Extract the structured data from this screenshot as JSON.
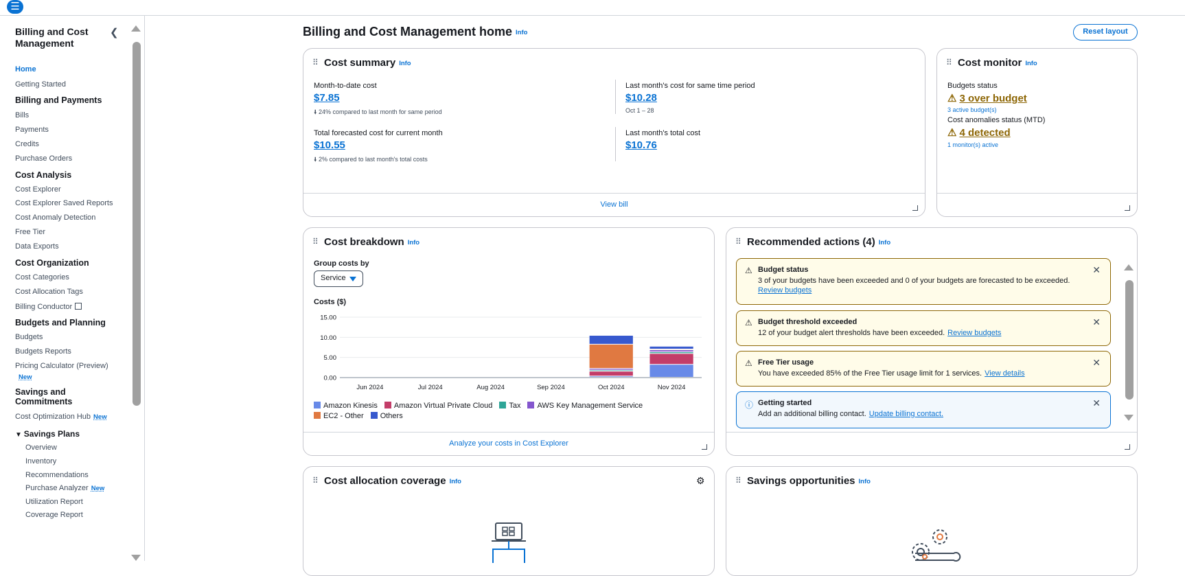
{
  "topbar": {
    "menu_icon": "hamburger-icon"
  },
  "sidebar": {
    "title": "Billing and Cost Management",
    "items": [
      {
        "label": "Home",
        "type": "item",
        "active": true
      },
      {
        "label": "Getting Started",
        "type": "item"
      },
      {
        "label": "Billing and Payments",
        "type": "head"
      },
      {
        "label": "Bills",
        "type": "item"
      },
      {
        "label": "Payments",
        "type": "item"
      },
      {
        "label": "Credits",
        "type": "item"
      },
      {
        "label": "Purchase Orders",
        "type": "item"
      },
      {
        "label": "Cost Analysis",
        "type": "head"
      },
      {
        "label": "Cost Explorer",
        "type": "item"
      },
      {
        "label": "Cost Explorer Saved Reports",
        "type": "item"
      },
      {
        "label": "Cost Anomaly Detection",
        "type": "item"
      },
      {
        "label": "Free Tier",
        "type": "item"
      },
      {
        "label": "Data Exports",
        "type": "item"
      },
      {
        "label": "Cost Organization",
        "type": "head"
      },
      {
        "label": "Cost Categories",
        "type": "item"
      },
      {
        "label": "Cost Allocation Tags",
        "type": "item"
      },
      {
        "label": "Billing Conductor",
        "type": "item",
        "external": true
      },
      {
        "label": "Budgets and Planning",
        "type": "head"
      },
      {
        "label": "Budgets",
        "type": "item"
      },
      {
        "label": "Budgets Reports",
        "type": "item"
      },
      {
        "label": "Pricing Calculator (Preview)",
        "type": "item"
      },
      {
        "label": "New",
        "type": "badge"
      },
      {
        "label": "Savings and",
        "type": "head"
      },
      {
        "label": "Commitments",
        "type": "head"
      },
      {
        "label": "Cost Optimization Hub",
        "type": "item",
        "badge": "New"
      },
      {
        "label": "Savings Plans",
        "type": "group"
      },
      {
        "label": "Overview",
        "type": "sub"
      },
      {
        "label": "Inventory",
        "type": "sub"
      },
      {
        "label": "Recommendations",
        "type": "sub"
      },
      {
        "label": "Purchase Analyzer",
        "type": "sub",
        "badge": "New"
      },
      {
        "label": "Utilization Report",
        "type": "sub"
      },
      {
        "label": "Coverage Report",
        "type": "sub"
      }
    ]
  },
  "page": {
    "title": "Billing and Cost Management home",
    "info": "Info",
    "reset_label": "Reset layout"
  },
  "cost_summary": {
    "title": "Cost summary",
    "info": "Info",
    "mtd_label": "Month-to-date cost",
    "mtd_value": "$7.85",
    "mtd_sub": "24% compared to last month for same period",
    "last_same_label": "Last month's cost for same time period",
    "last_same_value": "$10.28",
    "last_same_sub": "Oct 1 – 28",
    "forecast_label": "Total forecasted cost for current month",
    "forecast_value": "$10.55",
    "forecast_sub": "2% compared to last month's total costs",
    "last_total_label": "Last month's total cost",
    "last_total_value": "$10.76",
    "footer": "View bill"
  },
  "cost_monitor": {
    "title": "Cost monitor",
    "info": "Info",
    "budgets_label": "Budgets status",
    "budgets_value": "3 over budget",
    "budgets_sub": "3 active budget(s)",
    "anomalies_label": "Cost anomalies status (MTD)",
    "anomalies_value": "4 detected",
    "anomalies_sub": "1 monitor(s) active"
  },
  "cost_breakdown": {
    "title": "Cost breakdown",
    "info": "Info",
    "group_label": "Group costs by",
    "group_value": "Service",
    "footer": "Analyze your costs in Cost Explorer"
  },
  "chart_data": {
    "type": "bar",
    "stacked": true,
    "ylabel": "Costs ($)",
    "ylim": [
      0,
      15
    ],
    "yticks": [
      "15.00",
      "10.00",
      "5.00",
      "0.00"
    ],
    "categories": [
      "Jun 2024",
      "Jul 2024",
      "Aug 2024",
      "Sep 2024",
      "Oct 2024",
      "Nov 2024"
    ],
    "series": [
      {
        "name": "Amazon Kinesis",
        "color": "#688ae8",
        "values": [
          0,
          0,
          0,
          0,
          0.3,
          3.2
        ]
      },
      {
        "name": "Amazon Virtual Private Cloud",
        "color": "#c33d69",
        "values": [
          0,
          0,
          0,
          0,
          1.2,
          2.7
        ]
      },
      {
        "name": "Tax",
        "color": "#2ea597",
        "values": [
          0,
          0,
          0,
          0,
          0.3,
          0.4
        ]
      },
      {
        "name": "AWS Key Management Service",
        "color": "#8456ce",
        "values": [
          0,
          0,
          0,
          0,
          0.4,
          0.5
        ]
      },
      {
        "name": "EC2 - Other",
        "color": "#e07941",
        "values": [
          0,
          0,
          0,
          0,
          6.0,
          0.2
        ]
      },
      {
        "name": "Others",
        "color": "#3759ce",
        "values": [
          0,
          0,
          0,
          0,
          2.2,
          0.7
        ]
      }
    ],
    "grid": true,
    "legend": "bottom"
  },
  "recommended": {
    "title": "Recommended actions (4)",
    "info": "Info",
    "alerts": [
      {
        "title": "Budget status",
        "text": "3 of your budgets have been exceeded and 0 of your budgets are forecasted to be exceeded.",
        "link": "Review budgets",
        "kind": "warning"
      },
      {
        "title": "Budget threshold exceeded",
        "text": "12 of your budget alert thresholds have been exceeded.",
        "link": "Review budgets",
        "kind": "warning"
      },
      {
        "title": "Free Tier usage",
        "text": "You have exceeded 85% of the Free Tier usage limit for 1 services.",
        "link": "View details",
        "kind": "warning"
      },
      {
        "title": "Getting started",
        "text": "Add an additional billing contact.",
        "link": "Update billing contact.",
        "kind": "info"
      }
    ]
  },
  "cost_allocation": {
    "title": "Cost allocation coverage",
    "info": "Info"
  },
  "savings": {
    "title": "Savings opportunities",
    "info": "Info"
  }
}
